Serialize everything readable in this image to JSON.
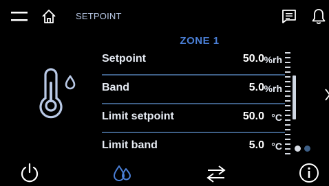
{
  "header": {
    "title": "SETPOINT",
    "menu_icon": "menu-icon",
    "home_icon": "home-icon",
    "message_icon": "message-icon",
    "bell_icon": "bell-icon"
  },
  "zone": {
    "title": "ZONE 1"
  },
  "illustration_icon": "thermometer-humidity-icon",
  "params": [
    {
      "label": "Setpoint",
      "value": "50.0",
      "unit": "%rh"
    },
    {
      "label": "Band",
      "value": "5.0",
      "unit": "%rh"
    },
    {
      "label": "Limit setpoint",
      "value": "50.0",
      "unit": "°C"
    },
    {
      "label": "Limit band",
      "value": "5.0",
      "unit": "°C"
    }
  ],
  "pagination": {
    "current": 1,
    "total": 2
  },
  "footer": {
    "power_icon": "power-icon",
    "humidity_icon": "humidity-drops-icon",
    "swap_icon": "swap-arrows-icon",
    "info_icon": "info-icon"
  },
  "colors": {
    "background": "#000000",
    "accent": "#4a7fd6",
    "divider": "#3e5f86",
    "text": "#ffffff",
    "icon_light": "#b9c9e6"
  }
}
